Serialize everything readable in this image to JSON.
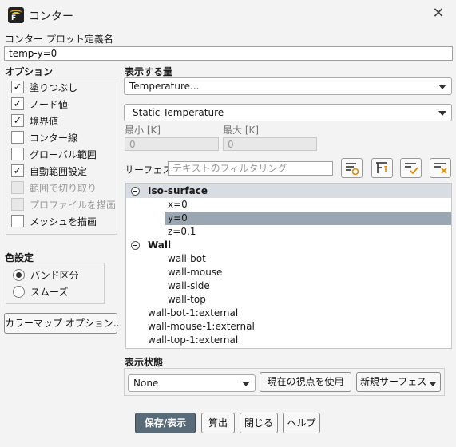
{
  "window": {
    "title": "コンター",
    "close_glyph": "✕"
  },
  "plot_name": {
    "label": "コンター プロット定義名",
    "value": "temp-y=0"
  },
  "options": {
    "label": "オプション",
    "items": [
      {
        "label": "塗りつぶし",
        "checked": true,
        "enabled": true
      },
      {
        "label": "ノード値",
        "checked": true,
        "enabled": true
      },
      {
        "label": "境界値",
        "checked": true,
        "enabled": true
      },
      {
        "label": "コンター線",
        "checked": false,
        "enabled": true
      },
      {
        "label": "グローバル範囲",
        "checked": false,
        "enabled": true
      },
      {
        "label": "自動範囲設定",
        "checked": true,
        "enabled": true
      },
      {
        "label": "範囲で切り取り",
        "checked": false,
        "enabled": false
      },
      {
        "label": "プロファイルを描画",
        "checked": false,
        "enabled": false
      },
      {
        "label": "メッシュを描画",
        "checked": false,
        "enabled": true
      }
    ]
  },
  "coloring": {
    "label": "色設定",
    "items": [
      {
        "label": "バンド区分",
        "selected": true
      },
      {
        "label": "スムーズ",
        "selected": false
      }
    ]
  },
  "colormap_button": "カラーマップ オプション...",
  "display_quantity": {
    "label": "表示する量",
    "value": "Temperature...",
    "sub_value": "Static Temperature"
  },
  "range": {
    "min_label": "最小 [K]",
    "min_value": "0",
    "max_label": "最大 [K]",
    "max_value": "0"
  },
  "surfaces": {
    "label": "サーフェス",
    "filter_placeholder": "テキストのフィルタリング",
    "tree": [
      {
        "text": "Iso-surface",
        "kind": "group"
      },
      {
        "text": "x=0",
        "kind": "child"
      },
      {
        "text": "y=0",
        "kind": "child-selected"
      },
      {
        "text": "z=0.1",
        "kind": "child"
      },
      {
        "text": "Wall",
        "kind": "group2"
      },
      {
        "text": "wall-bot",
        "kind": "child"
      },
      {
        "text": "wall-mouse",
        "kind": "child"
      },
      {
        "text": "wall-side",
        "kind": "child"
      },
      {
        "text": "wall-top",
        "kind": "child"
      },
      {
        "text": "wall-bot-1:external",
        "kind": "top"
      },
      {
        "text": "wall-mouse-1:external",
        "kind": "top"
      },
      {
        "text": "wall-top-1:external",
        "kind": "top"
      }
    ]
  },
  "view_state": {
    "label": "表示状態",
    "value": "None",
    "use_current_button": "現在の視点を使用",
    "new_surface_button": "新規サーフェス"
  },
  "footer": {
    "save_display": "保存/表示",
    "compute": "算出",
    "close": "閉じる",
    "help": "ヘルプ"
  }
}
